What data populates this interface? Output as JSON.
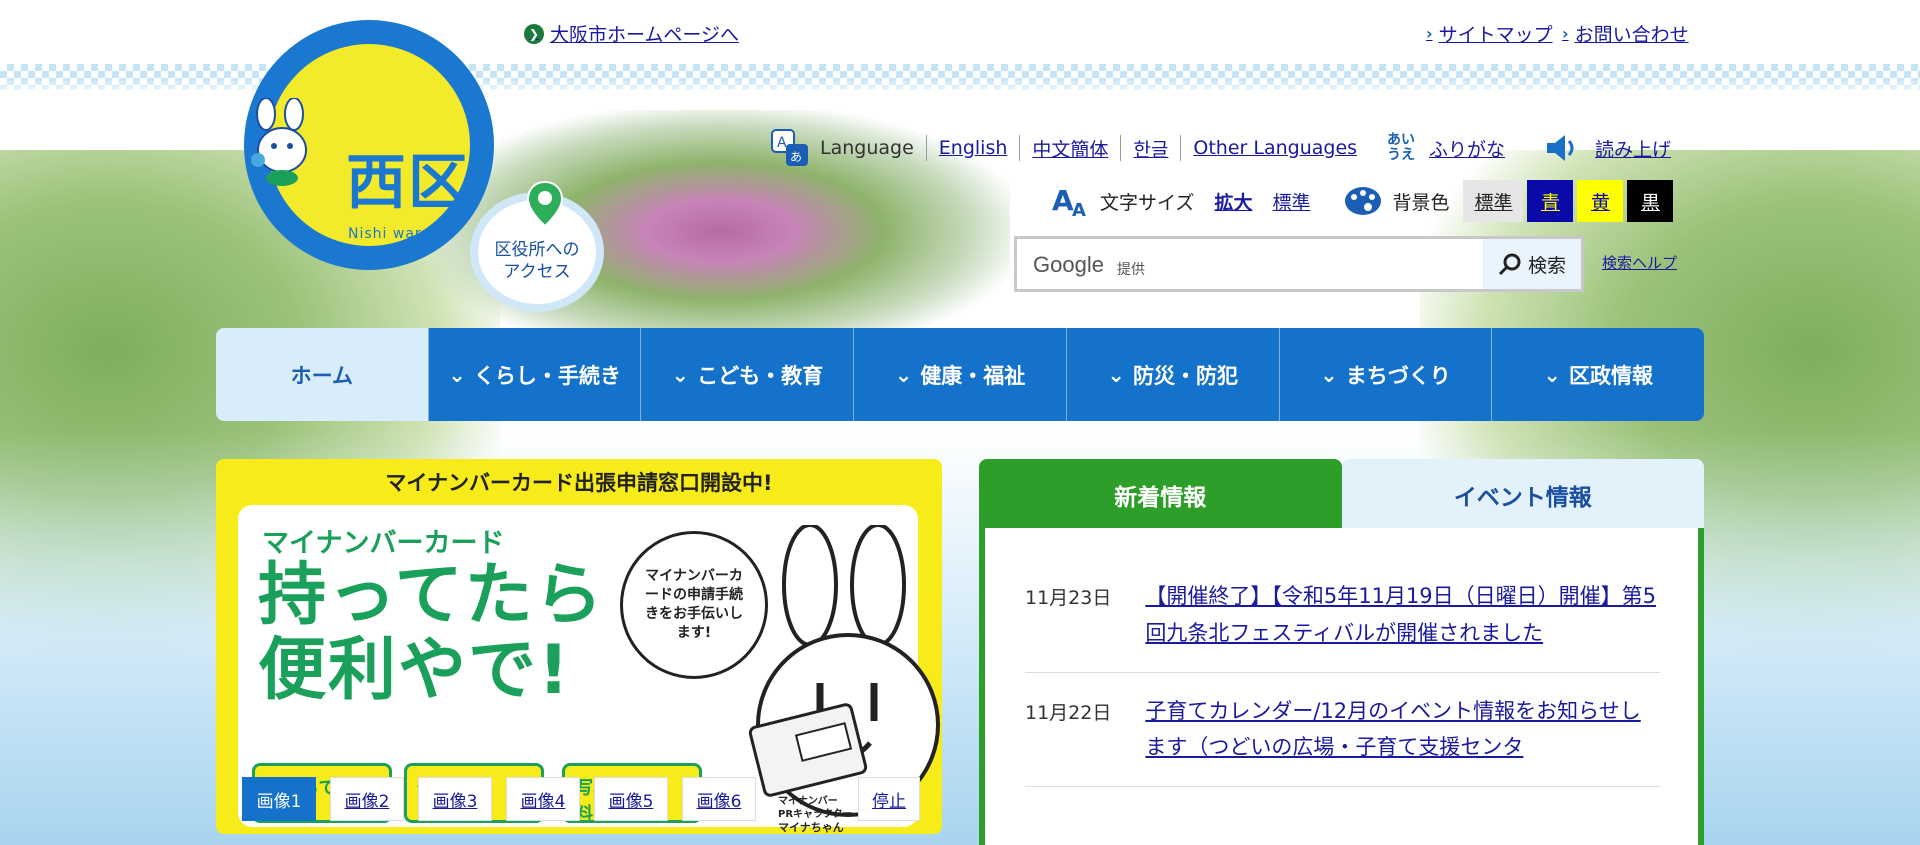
{
  "top_links": {
    "osaka_home": "大阪市ホームページへ",
    "sitemap": "サイトマップ",
    "contact": "お問い合わせ"
  },
  "logo": {
    "kanji": "西区",
    "romaji": "Nishi ward"
  },
  "access": {
    "line1": "区役所への",
    "line2": "アクセス"
  },
  "language": {
    "label": "Language",
    "options": [
      "English",
      "中文簡体",
      "한글",
      "Other Languages"
    ],
    "furigana_icon_text": "あいうえ",
    "furigana": "ふりがな",
    "read_aloud": "読み上げ"
  },
  "text_size": {
    "label": "文字サイズ",
    "enlarge": "拡大",
    "standard": "標準"
  },
  "bg_color": {
    "label": "背景色",
    "options": [
      {
        "label": "標準",
        "bg": "#e6e6e6",
        "fg": "#222222"
      },
      {
        "label": "青",
        "bg": "#0a0aa8",
        "fg": "#ffff00"
      },
      {
        "label": "黄",
        "bg": "#ffff00",
        "fg": "#0a0aa8"
      },
      {
        "label": "黒",
        "bg": "#000000",
        "fg": "#ffffff"
      }
    ]
  },
  "search": {
    "google_logo": "Google",
    "provider": "提供",
    "placeholder": "",
    "button": "検索",
    "help": "検索ヘルプ"
  },
  "nav": {
    "items": [
      "ホーム",
      "くらし・手続き",
      "こども・教育",
      "健康・福祉",
      "防災・防犯",
      "まちづくり",
      "区政情報"
    ]
  },
  "carousel": {
    "header": "マイナンバーカード出張申請窓口開設中!",
    "sub": "マイナンバーカード",
    "big_line1": "持ってたら",
    "big_line2": "便利やで!",
    "bubble": "マイナンバーカードの申請手続きをお手伝いします!",
    "badges": [
      "手ぶらでもOK",
      "予約不要",
      "写真撮影無料!"
    ],
    "credit_line1": "マイナンバー",
    "credit_line2": "PRキャラクター",
    "credit_line3": "マイナちゃん",
    "tabs": [
      "画像1",
      "画像2",
      "画像3",
      "画像4",
      "画像5",
      "画像6"
    ],
    "active_tab": 0,
    "stop": "停止"
  },
  "news": {
    "tabs": [
      "新着情報",
      "イベント情報"
    ],
    "items": [
      {
        "date": "11月23日",
        "title": "【開催終了】【令和5年11月19日（日曜日）開催】第5回九条北フェスティバルが開催されました"
      },
      {
        "date": "11月22日",
        "title": "子育てカレンダー/12月のイベント情報をお知らせします（つどいの広場・子育て支援センタ"
      }
    ]
  },
  "colors": {
    "nav_blue": "#1572cb",
    "news_green": "#2e9e2a",
    "logo_blue": "#1a78d0",
    "logo_yellow": "#f2ea2a",
    "link": "#1a1a9e"
  }
}
